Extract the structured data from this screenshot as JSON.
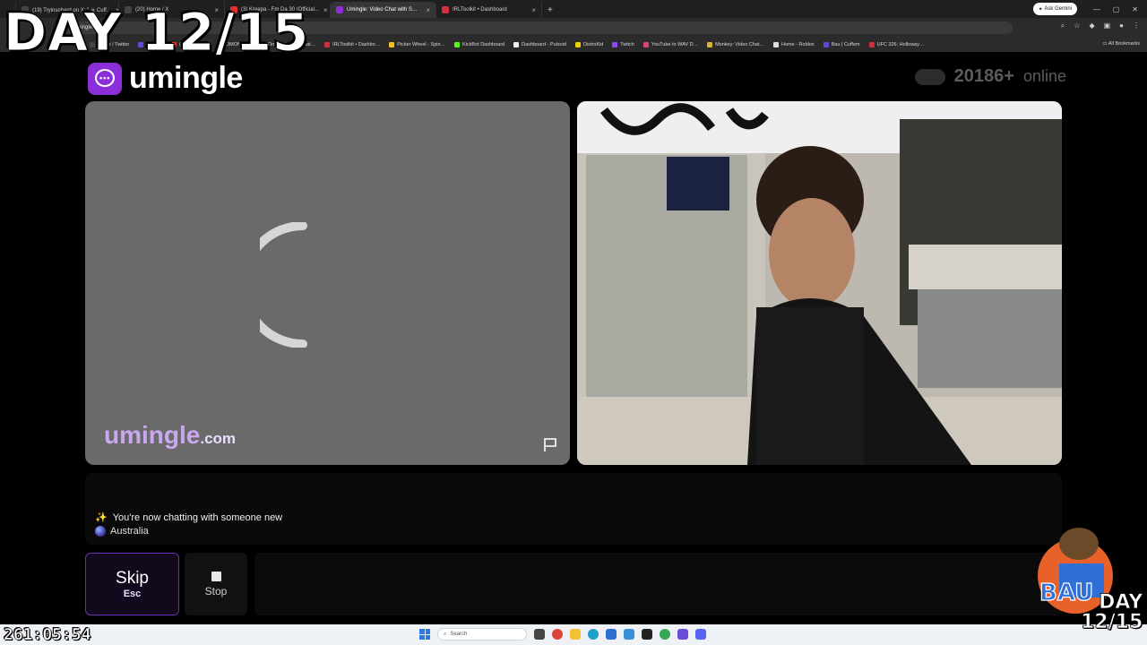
{
  "browser": {
    "tabs": [
      {
        "label": "(19) Tryinsohard on X: \" ☠ Cuff…",
        "color": "#444444"
      },
      {
        "label": "(20) Home / X",
        "color": "#444444"
      },
      {
        "label": "(3) Kreepa - Fm Da 30 (Official…",
        "color": "#e03030"
      },
      {
        "label": "Umingle: Video Chat with S…",
        "color": "#8b2fd8"
      },
      {
        "label": "IRLToolkit • Dashboard",
        "color": "#d0303a"
      }
    ],
    "ask_gemini": "Ask Gemini",
    "url": "umingle.com",
    "bookmarks": [
      {
        "label": "Home / Twitter",
        "color": "#444444"
      },
      {
        "label": "Cuffem",
        "color": "#5b4bd6"
      },
      {
        "label": "(57) YouTube",
        "color": "#e03030"
      },
      {
        "label": "OMONKEY",
        "color": "#d9b23a"
      },
      {
        "label": "OmeTV Video Chat…",
        "color": "#3a8fd9"
      },
      {
        "label": "IRLToolkit • Dashbo…",
        "color": "#d0303a"
      },
      {
        "label": "Picker Wheel - Spin…",
        "color": "#f0c020"
      },
      {
        "label": "KickBot Dashboard",
        "color": "#53fc18"
      },
      {
        "label": "Dashboard - Pulsoid",
        "color": "#eeeeee"
      },
      {
        "label": "DistroKid",
        "color": "#f0d000"
      },
      {
        "label": "Twitch",
        "color": "#9146ff"
      },
      {
        "label": "YouTube to WAV D…",
        "color": "#e04080"
      },
      {
        "label": "Monkey: Video Chat…",
        "color": "#d9b23a"
      },
      {
        "label": "Home - Roblox",
        "color": "#dddddd"
      },
      {
        "label": "Bau | Cuffem",
        "color": "#5b4bd6"
      },
      {
        "label": "UFC 326: Holloway…",
        "color": "#d0303a"
      }
    ],
    "all_bookmarks": "All Bookmarks"
  },
  "overlay": {
    "day_text": "DAY 12/15",
    "timer": "261:05:54",
    "badge_text": "BAU",
    "badge_day": "DAY\n12/15"
  },
  "app": {
    "logo_text": "umingle",
    "online_count": "20186+",
    "online_label": "online",
    "watermark_name": "umingle",
    "watermark_domain": ".com"
  },
  "chat": {
    "status_message": "You're now chatting with someone new",
    "country": "Australia"
  },
  "controls": {
    "skip_label": "Skip",
    "skip_shortcut": "Esc",
    "stop_label": "Stop"
  },
  "taskbar": {
    "search_label": "Search"
  },
  "colors": {
    "accent": "#8b2fd8",
    "watermark": "#c9a8f0"
  }
}
